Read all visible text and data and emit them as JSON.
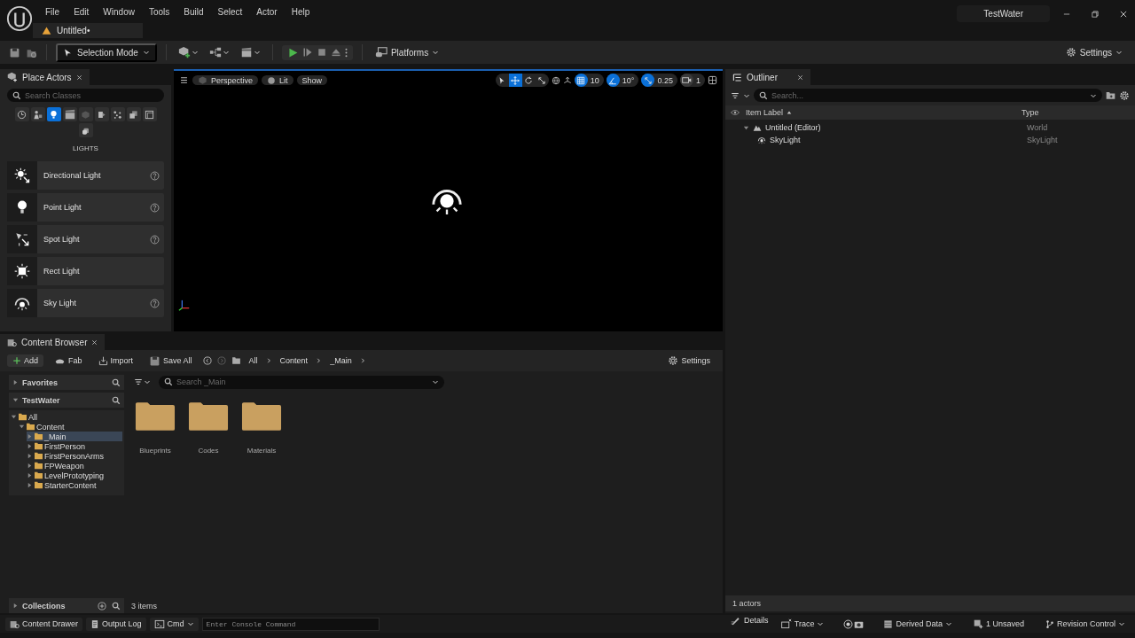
{
  "title_bar": {
    "menu": [
      "File",
      "Edit",
      "Window",
      "Tools",
      "Build",
      "Select",
      "Actor",
      "Help"
    ],
    "document_tab": "Untitled•",
    "project": "TestWater"
  },
  "toolbar": {
    "mode": "Selection Mode",
    "platforms": "Platforms",
    "settings": "Settings"
  },
  "place_actors": {
    "title": "Place Actors",
    "search": {
      "placeholder": "Search Classes"
    },
    "categories": [
      {
        "kind": "clock",
        "selected": false
      },
      {
        "kind": "actor",
        "selected": false
      },
      {
        "kind": "bulb",
        "selected": true
      },
      {
        "kind": "clapper",
        "selected": false
      },
      {
        "kind": "cube",
        "selected": false
      },
      {
        "kind": "volume",
        "selected": false
      },
      {
        "kind": "particles",
        "selected": false
      },
      {
        "kind": "boxes",
        "selected": false
      },
      {
        "kind": "panel",
        "selected": false
      },
      {
        "kind": "shape",
        "selected": false
      }
    ],
    "heading": "LIGHTS",
    "items": [
      {
        "name": "Directional Light",
        "kind": "directional",
        "help": true
      },
      {
        "name": "Point Light",
        "kind": "point",
        "help": true
      },
      {
        "name": "Spot Light",
        "kind": "spot",
        "help": true
      },
      {
        "name": "Rect Light",
        "kind": "rect",
        "help": false
      },
      {
        "name": "Sky Light",
        "kind": "sky",
        "help": true
      }
    ]
  },
  "viewport": {
    "view_buttons": [
      {
        "label": "Perspective",
        "kind": "cube"
      },
      {
        "label": "Lit",
        "kind": "sphere"
      },
      {
        "label": "Show",
        "kind": "plain"
      }
    ],
    "transform_tools": [
      {
        "kind": "select",
        "selected": false
      },
      {
        "kind": "move",
        "selected": true
      },
      {
        "kind": "rotate",
        "selected": false
      },
      {
        "kind": "scale",
        "selected": false
      }
    ],
    "snaps": [
      {
        "kind": "grid",
        "value": "10",
        "on": true
      },
      {
        "kind": "angle",
        "value": "10°",
        "on": true
      },
      {
        "kind": "scale",
        "value": "0.25",
        "on": true
      }
    ],
    "camera_speed": "1"
  },
  "outliner": {
    "title": "Outliner",
    "search": {
      "placeholder": "Search..."
    },
    "columns": [
      "Item Label",
      "Type"
    ],
    "rows": [
      {
        "label": "Untitled (Editor)",
        "type": "World",
        "kind": "world",
        "expanded": true,
        "children": [
          {
            "label": "SkyLight",
            "type": "SkyLight",
            "kind": "skylight"
          }
        ]
      }
    ],
    "footer": "1 actors"
  },
  "content_browser": {
    "title": "Content Browser",
    "toolbar": [
      {
        "label": "Add",
        "kind": "add"
      },
      {
        "label": "Fab",
        "kind": "fab"
      },
      {
        "label": "Import",
        "kind": "import"
      },
      {
        "label": "Save All",
        "kind": "save"
      }
    ],
    "breadcrumbs": [
      "All",
      "Content",
      "_Main"
    ],
    "settings": "Settings",
    "favorites": {
      "label": "Favorites",
      "expanded": false
    },
    "project": {
      "label": "TestWater",
      "expanded": true
    },
    "tree": [
      {
        "label": "All",
        "expanded": true,
        "selected": false,
        "children": [
          {
            "label": "Content",
            "expanded": true,
            "selected": false,
            "children": [
              {
                "label": "_Main",
                "expanded": false,
                "selected": true
              },
              {
                "label": "FirstPerson",
                "expanded": false,
                "selected": false
              },
              {
                "label": "FirstPersonArms",
                "expanded": false,
                "selected": false
              },
              {
                "label": "FPWeapon",
                "expanded": false,
                "selected": false
              },
              {
                "label": "LevelPrototyping",
                "expanded": false,
                "selected": false
              },
              {
                "label": "StarterContent",
                "expanded": false,
                "selected": false
              }
            ]
          }
        ]
      }
    ],
    "collections": {
      "label": "Collections",
      "expanded": false
    },
    "search": {
      "placeholder": "Search _Main"
    },
    "folders": [
      "Blueprints",
      "Codes",
      "Materials"
    ],
    "count": "3 items"
  },
  "status_bar": {
    "left": [
      {
        "label": "Content Drawer",
        "kind": "drawer"
      },
      {
        "label": "Output Log",
        "kind": "log"
      },
      {
        "label": "Cmd",
        "kind": "cmd"
      }
    ],
    "console": {
      "placeholder": "Enter Console Command"
    },
    "details_tab": "Details",
    "right": [
      {
        "label": "Trace",
        "kind": "trace"
      },
      {
        "label": "Derived Data",
        "kind": "derived"
      },
      {
        "label": "1 Unsaved",
        "kind": "unsaved"
      },
      {
        "label": "Revision Control",
        "kind": "revision"
      }
    ]
  }
}
